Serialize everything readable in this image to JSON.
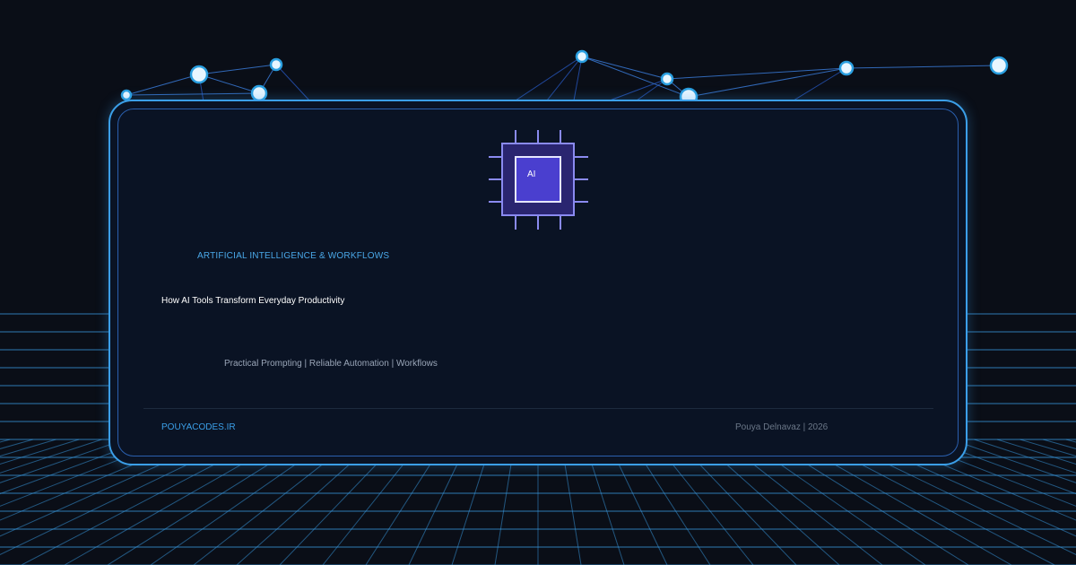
{
  "card": {
    "category": "ARTIFICIAL INTELLIGENCE & WORKFLOWS",
    "title": "How AI Tools Transform Everyday Productivity",
    "subtitle": "Practical Prompting | Reliable Automation | Workflows",
    "footer": {
      "site": "POUYACODES.IR",
      "author": "Pouya Delnavaz | 2026"
    }
  },
  "chip": {
    "label": "AI"
  },
  "decorations": {
    "network": "neural-network-icon",
    "grid": "perspective-grid",
    "chip_icon": "cpu-chip-icon"
  },
  "colors": {
    "background": "#0a0e17",
    "card": "#0a1324",
    "accent": "#3b9fe8",
    "chip": "#4a3fcf"
  }
}
